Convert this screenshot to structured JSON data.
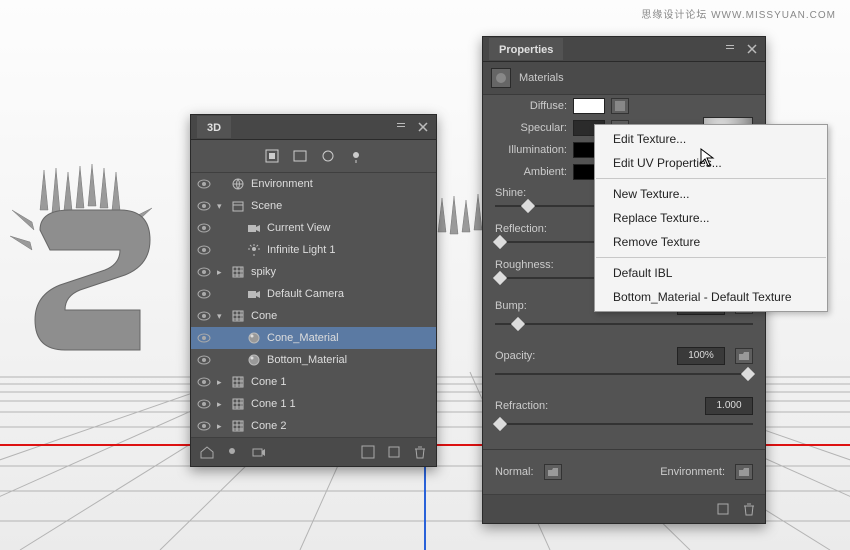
{
  "watermark": "思缘设计论坛  WWW.MISSYUAN.COM",
  "panel3d": {
    "title": "3D",
    "tree": [
      {
        "vis": true,
        "indent": 0,
        "arrow": "",
        "icon": "env",
        "label": "Environment"
      },
      {
        "vis": true,
        "indent": 0,
        "arrow": "▾",
        "icon": "scene",
        "label": "Scene"
      },
      {
        "vis": true,
        "indent": 1,
        "arrow": "",
        "icon": "cam",
        "label": "Current View"
      },
      {
        "vis": true,
        "indent": 1,
        "arrow": "",
        "icon": "light",
        "label": "Infinite Light 1"
      },
      {
        "vis": true,
        "indent": 0,
        "arrow": "▸",
        "icon": "mesh",
        "label": "spiky"
      },
      {
        "vis": true,
        "indent": 1,
        "arrow": "",
        "icon": "cam",
        "label": "Default Camera"
      },
      {
        "vis": true,
        "indent": 0,
        "arrow": "▾",
        "icon": "mesh",
        "label": "Cone"
      },
      {
        "vis": true,
        "indent": 1,
        "arrow": "",
        "icon": "mat",
        "label": "Cone_Material",
        "sel": true
      },
      {
        "vis": true,
        "indent": 1,
        "arrow": "",
        "icon": "mat",
        "label": "Bottom_Material"
      },
      {
        "vis": true,
        "indent": 0,
        "arrow": "▸",
        "icon": "mesh",
        "label": "Cone 1"
      },
      {
        "vis": true,
        "indent": 0,
        "arrow": "▸",
        "icon": "mesh",
        "label": "Cone 1 1"
      },
      {
        "vis": true,
        "indent": 0,
        "arrow": "▸",
        "icon": "mesh",
        "label": "Cone 2"
      }
    ]
  },
  "props": {
    "title": "Properties",
    "section": "Materials",
    "labels": {
      "diffuse": "Diffuse:",
      "specular": "Specular:",
      "illumination": "Illumination:",
      "ambient": "Ambient:",
      "shine": "Shine:",
      "reflection": "Reflection:",
      "roughness": "Roughness:",
      "bump": "Bump:",
      "opacity": "Opacity:",
      "refraction": "Refraction:",
      "normal": "Normal:",
      "environment": "Environment:"
    },
    "values": {
      "bump": "10%",
      "opacity": "100%",
      "refraction": "1.000"
    }
  },
  "menu": {
    "items": [
      {
        "label": "Edit Texture..."
      },
      {
        "label": "Edit UV Properties..."
      },
      {
        "sep": true
      },
      {
        "label": "New Texture..."
      },
      {
        "label": "Replace Texture..."
      },
      {
        "label": "Remove Texture"
      },
      {
        "sep": true
      },
      {
        "label": "Default IBL"
      },
      {
        "label": "Bottom_Material - Default Texture"
      }
    ]
  }
}
